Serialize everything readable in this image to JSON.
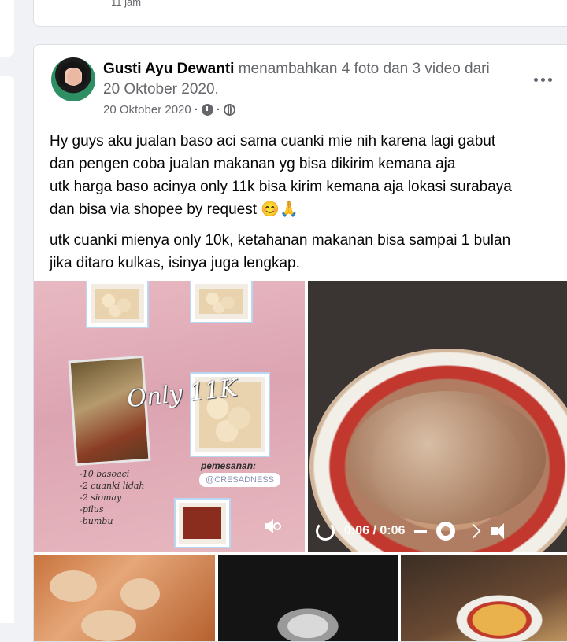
{
  "previous_post": {
    "time": "11 jam"
  },
  "post": {
    "author": "Gusti Ayu Dewanti",
    "action": "menambahkan 4 foto dan 3 video dari",
    "action_date": "20 Oktober 2020.",
    "date": "20 Oktober 2020",
    "separator": "·",
    "privacy_icon": "globe-icon",
    "body": [
      "Hy guys aku jualan baso aci sama cuanki mie nih karena lagi gabut",
      "dan pengen coba jualan makanan yg bisa dikirim kemana aja",
      "utk harga baso acinya only 11k bisa kirim kemana aja lokasi surabaya",
      "dan bisa via shopee by request 😊🙏",
      "utk cuanki mienya only 10k, ketahanan makanan bisa sampai 1 bulan",
      "jika ditaro kulkas, isinya juga lengkap."
    ],
    "media1": {
      "overlay_text": "Only 11K",
      "order_label": "pemesanan:",
      "handle": "@CRESADNESS",
      "handwritten": [
        "-10 basoaci",
        "-2 cuanki lidah",
        "-2 siomay",
        "-pilus",
        "-bumbu"
      ]
    },
    "video": {
      "time": "0:06 / 0:06"
    }
  }
}
